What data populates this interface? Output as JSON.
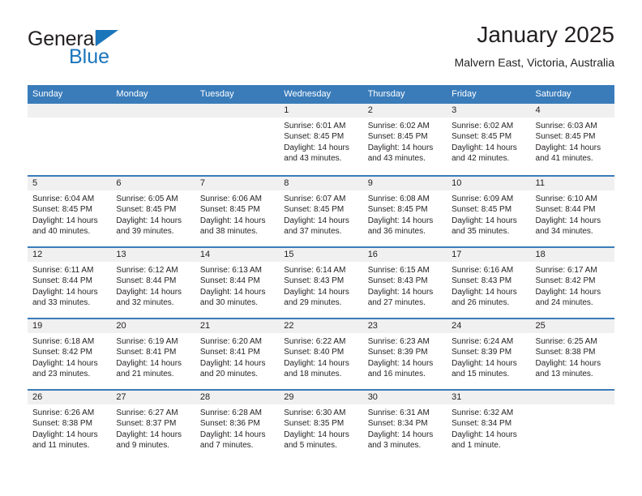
{
  "brand": {
    "name_part1": "General",
    "name_part2": "Blue",
    "triangle_color": "#1b75bb",
    "text_color": "#231f20"
  },
  "header": {
    "title": "January 2025",
    "subtitle": "Malvern East, Victoria, Australia"
  },
  "theme": {
    "header_bar_color": "#3a7cba",
    "day_band_color": "#f0f0f0",
    "row_separator_color": "#3a7cba",
    "background": "#ffffff",
    "text_color": "#231f20"
  },
  "weekdays": [
    "Sunday",
    "Monday",
    "Tuesday",
    "Wednesday",
    "Thursday",
    "Friday",
    "Saturday"
  ],
  "labels": {
    "sunrise": "Sunrise:",
    "sunset": "Sunset:",
    "daylight": "Daylight:"
  },
  "weeks": [
    [
      {
        "day": "",
        "empty": true
      },
      {
        "day": "",
        "empty": true
      },
      {
        "day": "",
        "empty": true
      },
      {
        "day": "1",
        "sunrise": "Sunrise: 6:01 AM",
        "sunset": "Sunset: 8:45 PM",
        "daylight": "Daylight: 14 hours and 43 minutes."
      },
      {
        "day": "2",
        "sunrise": "Sunrise: 6:02 AM",
        "sunset": "Sunset: 8:45 PM",
        "daylight": "Daylight: 14 hours and 43 minutes."
      },
      {
        "day": "3",
        "sunrise": "Sunrise: 6:02 AM",
        "sunset": "Sunset: 8:45 PM",
        "daylight": "Daylight: 14 hours and 42 minutes."
      },
      {
        "day": "4",
        "sunrise": "Sunrise: 6:03 AM",
        "sunset": "Sunset: 8:45 PM",
        "daylight": "Daylight: 14 hours and 41 minutes."
      }
    ],
    [
      {
        "day": "5",
        "sunrise": "Sunrise: 6:04 AM",
        "sunset": "Sunset: 8:45 PM",
        "daylight": "Daylight: 14 hours and 40 minutes."
      },
      {
        "day": "6",
        "sunrise": "Sunrise: 6:05 AM",
        "sunset": "Sunset: 8:45 PM",
        "daylight": "Daylight: 14 hours and 39 minutes."
      },
      {
        "day": "7",
        "sunrise": "Sunrise: 6:06 AM",
        "sunset": "Sunset: 8:45 PM",
        "daylight": "Daylight: 14 hours and 38 minutes."
      },
      {
        "day": "8",
        "sunrise": "Sunrise: 6:07 AM",
        "sunset": "Sunset: 8:45 PM",
        "daylight": "Daylight: 14 hours and 37 minutes."
      },
      {
        "day": "9",
        "sunrise": "Sunrise: 6:08 AM",
        "sunset": "Sunset: 8:45 PM",
        "daylight": "Daylight: 14 hours and 36 minutes."
      },
      {
        "day": "10",
        "sunrise": "Sunrise: 6:09 AM",
        "sunset": "Sunset: 8:45 PM",
        "daylight": "Daylight: 14 hours and 35 minutes."
      },
      {
        "day": "11",
        "sunrise": "Sunrise: 6:10 AM",
        "sunset": "Sunset: 8:44 PM",
        "daylight": "Daylight: 14 hours and 34 minutes."
      }
    ],
    [
      {
        "day": "12",
        "sunrise": "Sunrise: 6:11 AM",
        "sunset": "Sunset: 8:44 PM",
        "daylight": "Daylight: 14 hours and 33 minutes."
      },
      {
        "day": "13",
        "sunrise": "Sunrise: 6:12 AM",
        "sunset": "Sunset: 8:44 PM",
        "daylight": "Daylight: 14 hours and 32 minutes."
      },
      {
        "day": "14",
        "sunrise": "Sunrise: 6:13 AM",
        "sunset": "Sunset: 8:44 PM",
        "daylight": "Daylight: 14 hours and 30 minutes."
      },
      {
        "day": "15",
        "sunrise": "Sunrise: 6:14 AM",
        "sunset": "Sunset: 8:43 PM",
        "daylight": "Daylight: 14 hours and 29 minutes."
      },
      {
        "day": "16",
        "sunrise": "Sunrise: 6:15 AM",
        "sunset": "Sunset: 8:43 PM",
        "daylight": "Daylight: 14 hours and 27 minutes."
      },
      {
        "day": "17",
        "sunrise": "Sunrise: 6:16 AM",
        "sunset": "Sunset: 8:43 PM",
        "daylight": "Daylight: 14 hours and 26 minutes."
      },
      {
        "day": "18",
        "sunrise": "Sunrise: 6:17 AM",
        "sunset": "Sunset: 8:42 PM",
        "daylight": "Daylight: 14 hours and 24 minutes."
      }
    ],
    [
      {
        "day": "19",
        "sunrise": "Sunrise: 6:18 AM",
        "sunset": "Sunset: 8:42 PM",
        "daylight": "Daylight: 14 hours and 23 minutes."
      },
      {
        "day": "20",
        "sunrise": "Sunrise: 6:19 AM",
        "sunset": "Sunset: 8:41 PM",
        "daylight": "Daylight: 14 hours and 21 minutes."
      },
      {
        "day": "21",
        "sunrise": "Sunrise: 6:20 AM",
        "sunset": "Sunset: 8:41 PM",
        "daylight": "Daylight: 14 hours and 20 minutes."
      },
      {
        "day": "22",
        "sunrise": "Sunrise: 6:22 AM",
        "sunset": "Sunset: 8:40 PM",
        "daylight": "Daylight: 14 hours and 18 minutes."
      },
      {
        "day": "23",
        "sunrise": "Sunrise: 6:23 AM",
        "sunset": "Sunset: 8:39 PM",
        "daylight": "Daylight: 14 hours and 16 minutes."
      },
      {
        "day": "24",
        "sunrise": "Sunrise: 6:24 AM",
        "sunset": "Sunset: 8:39 PM",
        "daylight": "Daylight: 14 hours and 15 minutes."
      },
      {
        "day": "25",
        "sunrise": "Sunrise: 6:25 AM",
        "sunset": "Sunset: 8:38 PM",
        "daylight": "Daylight: 14 hours and 13 minutes."
      }
    ],
    [
      {
        "day": "26",
        "sunrise": "Sunrise: 6:26 AM",
        "sunset": "Sunset: 8:38 PM",
        "daylight": "Daylight: 14 hours and 11 minutes."
      },
      {
        "day": "27",
        "sunrise": "Sunrise: 6:27 AM",
        "sunset": "Sunset: 8:37 PM",
        "daylight": "Daylight: 14 hours and 9 minutes."
      },
      {
        "day": "28",
        "sunrise": "Sunrise: 6:28 AM",
        "sunset": "Sunset: 8:36 PM",
        "daylight": "Daylight: 14 hours and 7 minutes."
      },
      {
        "day": "29",
        "sunrise": "Sunrise: 6:30 AM",
        "sunset": "Sunset: 8:35 PM",
        "daylight": "Daylight: 14 hours and 5 minutes."
      },
      {
        "day": "30",
        "sunrise": "Sunrise: 6:31 AM",
        "sunset": "Sunset: 8:34 PM",
        "daylight": "Daylight: 14 hours and 3 minutes."
      },
      {
        "day": "31",
        "sunrise": "Sunrise: 6:32 AM",
        "sunset": "Sunset: 8:34 PM",
        "daylight": "Daylight: 14 hours and 1 minute."
      },
      {
        "day": "",
        "empty": true
      }
    ]
  ]
}
